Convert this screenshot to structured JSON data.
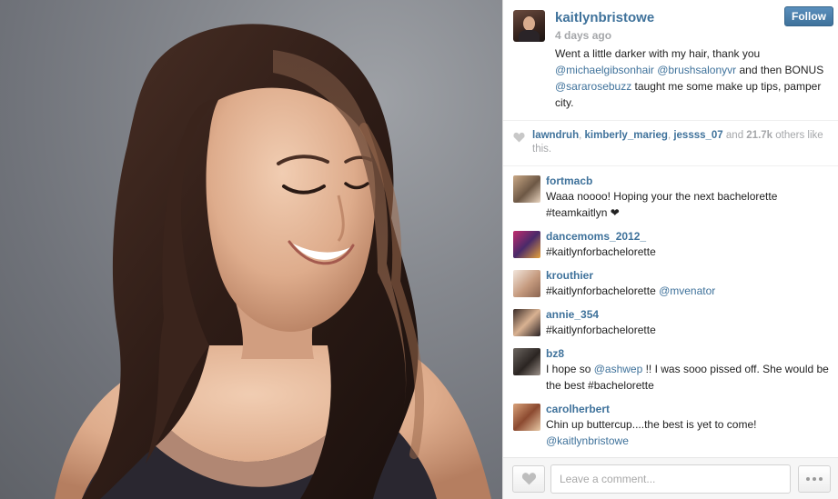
{
  "post": {
    "username": "kaitlynbristowe",
    "time_ago": "4 days ago",
    "follow_label": "Follow",
    "caption": {
      "t1": "Went a little darker with my hair, thank you ",
      "m1": "@michaelgibsonhair",
      "t2": " ",
      "m2": "@brushsalonyvr",
      "t3": " and then BONUS ",
      "m3": "@sararosebuzz",
      "t4": " taught me some make up tips, pamper city."
    }
  },
  "likes": {
    "likers": [
      "lawndruh",
      "kimberly_marieg",
      "jessss_07"
    ],
    "sep": ", ",
    "and_text": " and ",
    "count": "21.7k",
    "others_text": " others like this."
  },
  "comments": [
    {
      "user": "fortmacb",
      "text": "Waaa noooo! Hoping your the next bachelorette #teamkaitlyn ❤"
    },
    {
      "user": "dancemoms_2012_",
      "text": "#kaitlynforbachelorette"
    },
    {
      "user": "krouthier",
      "text": "#kaitlynforbachelorette ",
      "mention": "@mvenator",
      "after": ""
    },
    {
      "user": "annie_354",
      "text": "#kaitlynforbachelorette"
    },
    {
      "user": "bz8",
      "text": "I hope so ",
      "mention": "@ashwep",
      "after": " !! I was sooo pissed off. She would be the best #bachelorette"
    },
    {
      "user": "carolherbert",
      "text": "Chin up buttercup....the best is yet to come! ",
      "mention": "@kaitlynbristowe",
      "after": ""
    }
  ],
  "footer": {
    "comment_placeholder": "Leave a comment..."
  },
  "icons": {
    "heart": "heart-icon",
    "more": "more-options-icon"
  },
  "colors": {
    "link": "#3f729b",
    "muted": "#a5a7aa",
    "follow_button": "#3f729b"
  }
}
